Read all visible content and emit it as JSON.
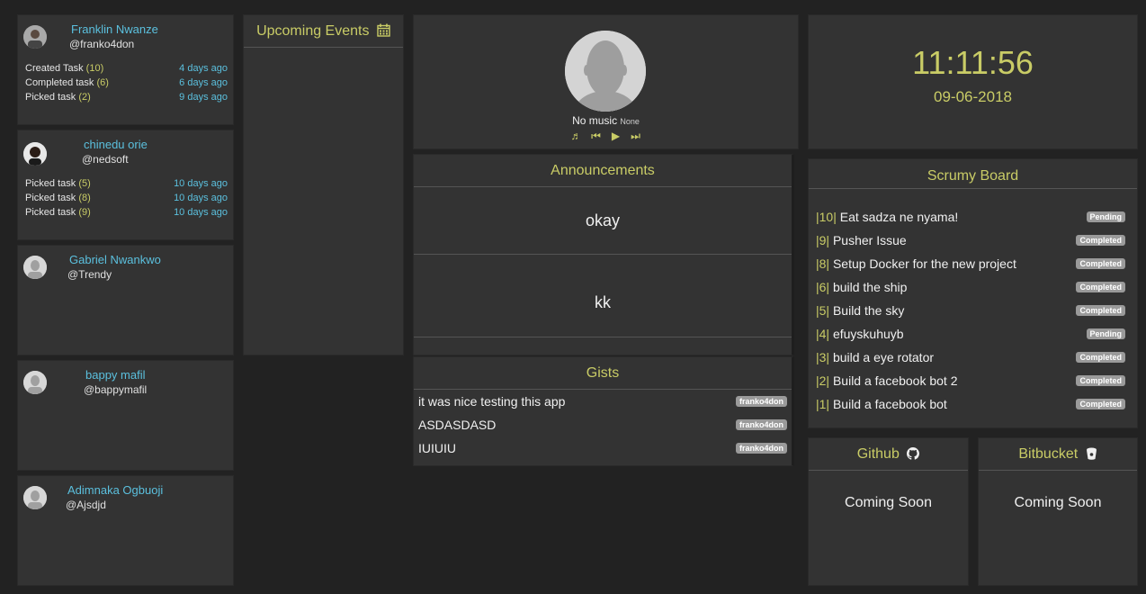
{
  "users": [
    {
      "name": "Franklin Nwanze",
      "handle": "@franko4don",
      "activities": [
        {
          "label": "Created Task",
          "count": "(10)",
          "ago": "4 days ago"
        },
        {
          "label": "Completed task",
          "count": "(6)",
          "ago": "6 days ago"
        },
        {
          "label": "Picked task",
          "count": "(2)",
          "ago": "9 days ago"
        }
      ]
    },
    {
      "name": "chinedu orie",
      "handle": "@nedsoft",
      "activities": [
        {
          "label": "Picked task",
          "count": "(5)",
          "ago": "10 days ago"
        },
        {
          "label": "Picked task",
          "count": "(8)",
          "ago": "10 days ago"
        },
        {
          "label": "Picked task",
          "count": "(9)",
          "ago": "10 days ago"
        }
      ]
    },
    {
      "name": "Gabriel Nwankwo",
      "handle": "@Trendy",
      "activities": []
    },
    {
      "name": "bappy mafil",
      "handle": "@bappymafil",
      "activities": []
    },
    {
      "name": "Adimnaka Ogbuoji",
      "handle": "@Ajsdjd",
      "activities": []
    }
  ],
  "events": {
    "title": "Upcoming Events",
    "icon": "calendar-icon"
  },
  "music": {
    "title": "No music",
    "artist": "None",
    "controls": [
      "music-note-icon",
      "previous-icon",
      "play-icon",
      "next-icon"
    ]
  },
  "announcements": {
    "title": "Announcements",
    "items": [
      "okay",
      "kk"
    ]
  },
  "gists": {
    "title": "Gists",
    "items": [
      {
        "text": "it was nice testing this app",
        "author": "franko4don"
      },
      {
        "text": "ASDASDASD",
        "author": "franko4don"
      },
      {
        "text": "IUIUIU",
        "author": "franko4don"
      }
    ]
  },
  "clock": {
    "time": "11:11:56",
    "date": "09-06-2018"
  },
  "scrumy": {
    "title": "Scrumy Board",
    "tasks": [
      {
        "id": "|10|",
        "name": "Eat sadza ne nyama!",
        "status": "Pending"
      },
      {
        "id": "|9|",
        "name": "Pusher Issue",
        "status": "Completed"
      },
      {
        "id": "|8|",
        "name": "Setup Docker for the new project",
        "status": "Completed"
      },
      {
        "id": "|6|",
        "name": "build the ship",
        "status": "Completed"
      },
      {
        "id": "|5|",
        "name": "Build the sky",
        "status": "Completed"
      },
      {
        "id": "|4|",
        "name": "efuyskuhuyb",
        "status": "Pending"
      },
      {
        "id": "|3|",
        "name": "build a eye rotator",
        "status": "Completed"
      },
      {
        "id": "|2|",
        "name": "Build a facebook bot 2",
        "status": "Completed"
      },
      {
        "id": "|1|",
        "name": "Build a facebook bot",
        "status": "Completed"
      }
    ]
  },
  "github": {
    "title": "Github",
    "body": "Coming Soon"
  },
  "bitbucket": {
    "title": "Bitbucket",
    "body": "Coming Soon"
  },
  "colors": {
    "background": "#222222",
    "panel": "#333333",
    "accent": "#c9cc66",
    "link": "#5bc0de",
    "badge": "#9a9a9a"
  }
}
